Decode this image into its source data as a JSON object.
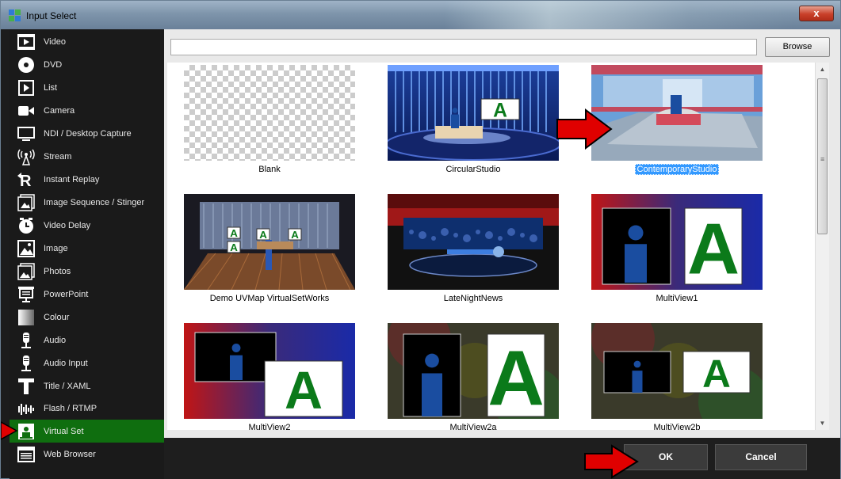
{
  "window": {
    "title": "Input Select",
    "close_label": "x"
  },
  "sidebar": {
    "items": [
      {
        "label": "Video",
        "icon": "video-icon"
      },
      {
        "label": "DVD",
        "icon": "dvd-icon"
      },
      {
        "label": "List",
        "icon": "list-icon"
      },
      {
        "label": "Camera",
        "icon": "camera-icon"
      },
      {
        "label": "NDI / Desktop Capture",
        "icon": "monitor-icon"
      },
      {
        "label": "Stream",
        "icon": "stream-icon"
      },
      {
        "label": "Instant Replay",
        "icon": "replay-icon"
      },
      {
        "label": "Image Sequence / Stinger",
        "icon": "image-sequence-icon"
      },
      {
        "label": "Video Delay",
        "icon": "clock-icon"
      },
      {
        "label": "Image",
        "icon": "image-icon"
      },
      {
        "label": "Photos",
        "icon": "photos-icon"
      },
      {
        "label": "PowerPoint",
        "icon": "presentation-icon"
      },
      {
        "label": "Colour",
        "icon": "colour-icon"
      },
      {
        "label": "Audio",
        "icon": "microphone-icon"
      },
      {
        "label": "Audio Input",
        "icon": "microphone-icon"
      },
      {
        "label": "Title / XAML",
        "icon": "title-icon"
      },
      {
        "label": "Flash / RTMP",
        "icon": "waveform-icon"
      },
      {
        "label": "Virtual Set",
        "icon": "virtual-set-icon",
        "selected": true
      },
      {
        "label": "Web Browser",
        "icon": "browser-icon"
      }
    ]
  },
  "main": {
    "path_value": "",
    "browse_label": "Browse",
    "tiles": [
      {
        "label": "Blank"
      },
      {
        "label": "CircularStudio"
      },
      {
        "label": "ContemporaryStudio",
        "selected": true
      },
      {
        "label": "Demo UVMap VirtualSetWorks"
      },
      {
        "label": "LateNightNews"
      },
      {
        "label": "MultiView1"
      },
      {
        "label": "MultiView2"
      },
      {
        "label": "MultiView2a"
      },
      {
        "label": "MultiView2b"
      }
    ],
    "thumb_letter": "A"
  },
  "footer": {
    "ok_label": "OK",
    "cancel_label": "Cancel"
  },
  "colors": {
    "selected_green": "#0f6e0f",
    "selection_blue": "#3399ff",
    "annotation_red": "#e00000"
  }
}
